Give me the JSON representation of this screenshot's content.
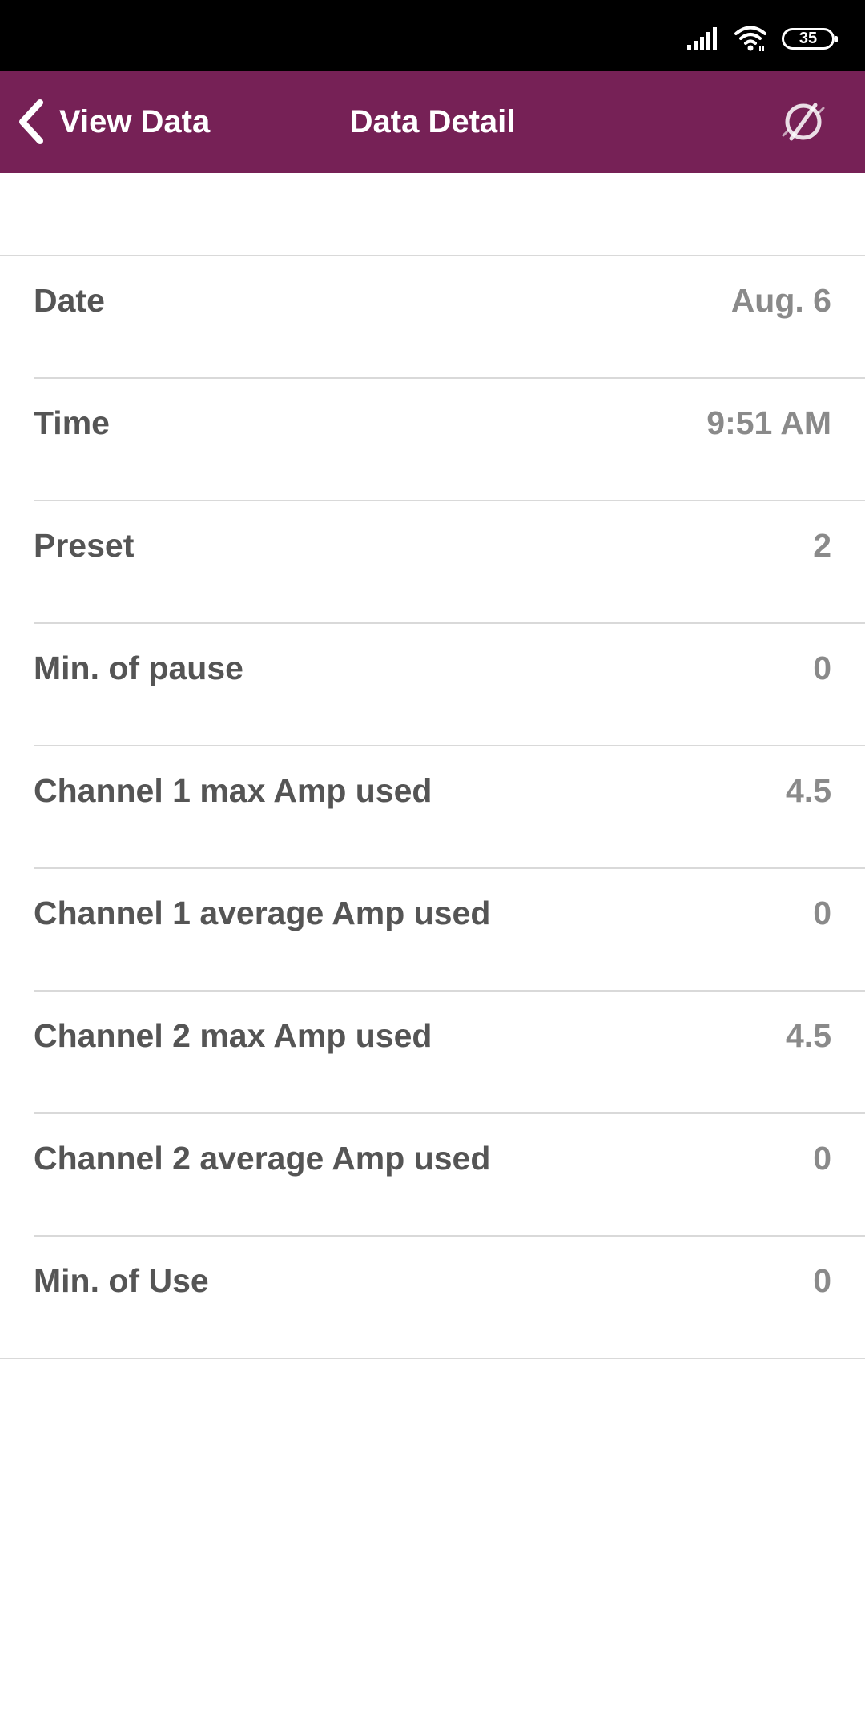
{
  "status_bar": {
    "battery_level": "35",
    "icons": [
      "signal-icon",
      "wifi-icon",
      "battery-icon"
    ]
  },
  "header": {
    "back_label": "View Data",
    "title": "Data Detail",
    "right_icon": "disconnect-icon",
    "background_color": "#762156"
  },
  "rows": [
    {
      "label": "Date",
      "value": "Aug. 6"
    },
    {
      "label": "Time",
      "value": "9:51 AM"
    },
    {
      "label": "Preset",
      "value": "2"
    },
    {
      "label": "Min. of pause",
      "value": "0"
    },
    {
      "label": "Channel 1 max Amp used",
      "value": "4.5"
    },
    {
      "label": "Channel 1 average Amp used",
      "value": "0"
    },
    {
      "label": "Channel 2 max Amp used",
      "value": "4.5"
    },
    {
      "label": "Channel 2 average Amp used",
      "value": "0"
    },
    {
      "label": "Min. of Use",
      "value": "0"
    }
  ]
}
